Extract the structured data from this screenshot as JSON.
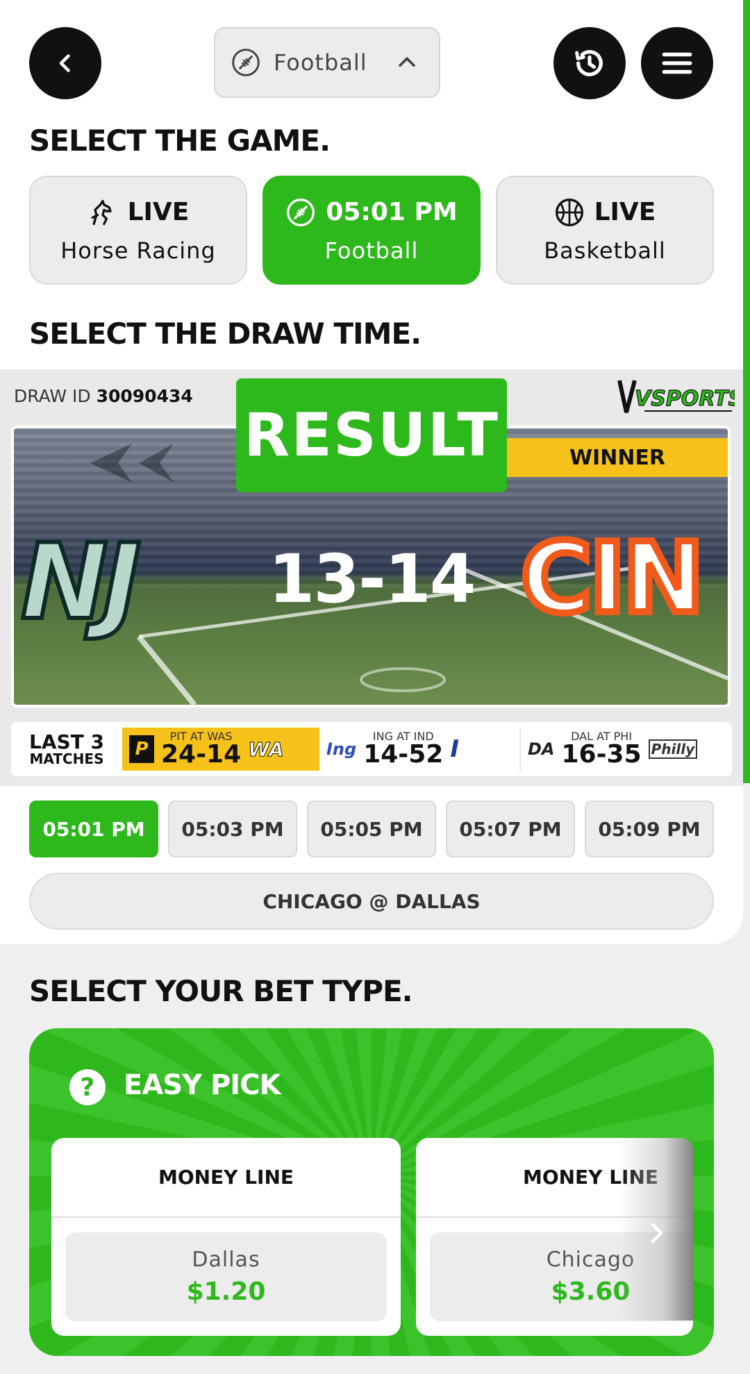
{
  "header": {
    "sport_selector_label": "Football"
  },
  "sections": {
    "select_game": "SELECT THE GAME.",
    "select_draw_time": "SELECT THE DRAW TIME.",
    "select_bet_type": "SELECT YOUR BET TYPE."
  },
  "games": [
    {
      "status": "LIVE",
      "name": "Horse Racing",
      "icon": "horse-icon",
      "active": false
    },
    {
      "status": "05:01 PM",
      "name": "Football",
      "icon": "football-icon",
      "active": true
    },
    {
      "status": "LIVE",
      "name": "Basketball",
      "icon": "basketball-icon",
      "active": false
    }
  ],
  "draw": {
    "id_label": "DRAW ID",
    "id_value": "30090434",
    "provider_logo": "VSPORTS",
    "result_label": "RESULT",
    "winner_label": "WINNER",
    "home_team_logo": "NJ",
    "away_team_logo": "CIN",
    "score": "13-14"
  },
  "last_matches": {
    "label_line1": "LAST 3",
    "label_line2": "MATCHES",
    "items": [
      {
        "caption": "PIT AT WAS",
        "score": "24-14",
        "left_logo": "P",
        "right_logo": "WA"
      },
      {
        "caption": "ING AT IND",
        "score": "14-52",
        "left_logo": "Ing",
        "right_logo": "I"
      },
      {
        "caption": "DAL AT PHI",
        "score": "16-35",
        "left_logo": "DA",
        "right_logo": "Philly"
      }
    ]
  },
  "draw_times": [
    "05:01 PM",
    "05:03 PM",
    "05:05 PM",
    "05:07 PM",
    "05:09 PM"
  ],
  "selected_draw_time": "05:01 PM",
  "matchup": "CHICAGO @ DALLAS",
  "bet": {
    "easy_pick_label": "EASY PICK",
    "cards": [
      {
        "title": "MONEY LINE",
        "team": "Dallas",
        "price": "$1.20"
      },
      {
        "title": "MONEY LINE",
        "team": "Chicago",
        "price": "$3.60"
      }
    ]
  },
  "colors": {
    "accent": "#2db81b",
    "winner_yellow": "#f6c21a",
    "dark": "#111111",
    "pill_bg": "#ececec"
  }
}
